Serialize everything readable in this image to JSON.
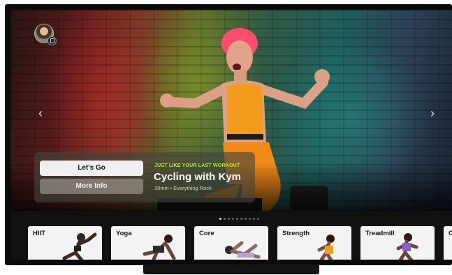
{
  "hero": {
    "kicker": "JUST LIKE YOUR LAST WORKOUT",
    "title": "Cycling with Kym",
    "meta": "20min • Everything Rock",
    "primary_button": "Let's Go",
    "secondary_button": "More Info",
    "page_count": 10,
    "active_page": 1
  },
  "icons": {
    "left_arrow": "chevron-left-icon",
    "right_arrow": "chevron-right-icon",
    "left_glyph": "‹",
    "right_glyph": "›"
  },
  "categories": [
    {
      "label": "HIIT"
    },
    {
      "label": "Yoga"
    },
    {
      "label": "Core"
    },
    {
      "label": "Strength"
    },
    {
      "label": "Treadmill"
    },
    {
      "label": "C"
    }
  ],
  "colors": {
    "accent": "#b8ee2e",
    "top_outfit": "#f29b1d"
  }
}
